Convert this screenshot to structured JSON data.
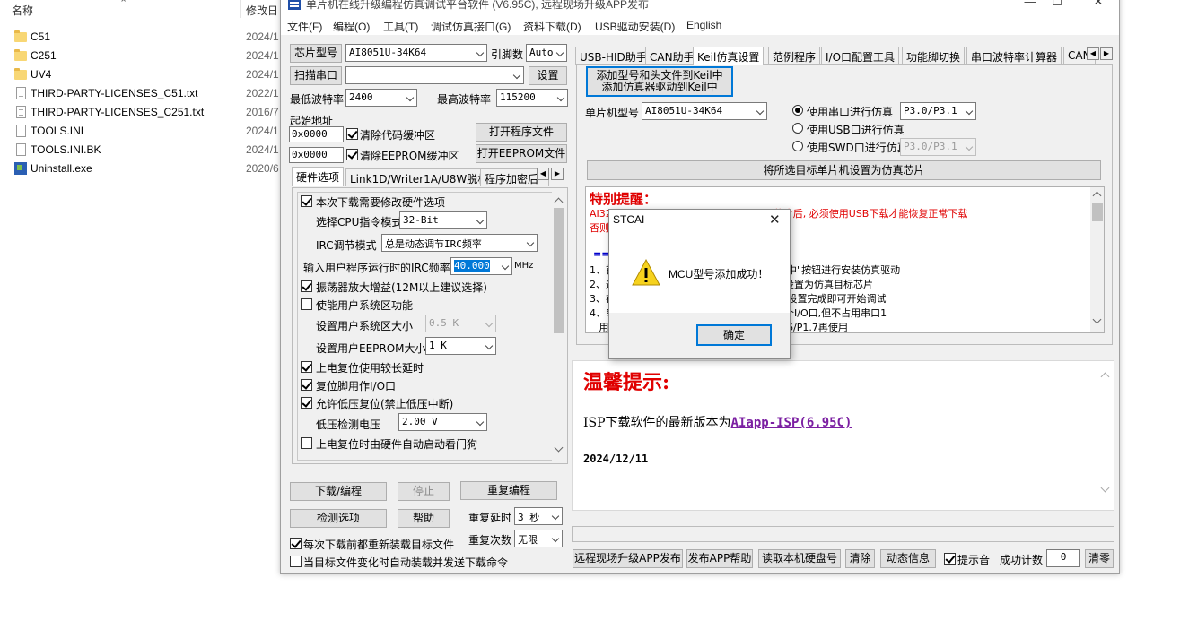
{
  "explorer": {
    "col_name": "名称",
    "col_date": "修改日",
    "files": [
      {
        "name": "C51",
        "date": "2024/1",
        "icon": "folder-icon"
      },
      {
        "name": "C251",
        "date": "2024/1",
        "icon": "folder-icon"
      },
      {
        "name": "UV4",
        "date": "2024/1",
        "icon": "folder-icon"
      },
      {
        "name": "THIRD-PARTY-LICENSES_C51.txt",
        "date": "2022/1",
        "icon": "text-file-icon"
      },
      {
        "name": "THIRD-PARTY-LICENSES_C251.txt",
        "date": "2016/7",
        "icon": "text-file-icon"
      },
      {
        "name": "TOOLS.INI",
        "date": "2024/1",
        "icon": "ini-file-icon"
      },
      {
        "name": "TOOLS.INI.BK",
        "date": "2024/1",
        "icon": "file-icon"
      },
      {
        "name": "Uninstall.exe",
        "date": "2020/6",
        "icon": "exe-icon"
      }
    ]
  },
  "window": {
    "title": "单片机在线升级编程仿真调试平台软件 (V6.95C), 远程现场升级APP发布",
    "menu": [
      "文件(F)",
      "编程(O)",
      "工具(T)",
      "调试仿真接口(G)",
      "资料下载(D)",
      "USB驱动安装(D)",
      "English"
    ]
  },
  "left": {
    "chip_label": "芯片型号",
    "chip_value": "AI8051U-34K64",
    "pin_label": "引脚数",
    "pin_value": "Auto",
    "scan_label": "扫描串口",
    "port_value": "",
    "settings_label": "设置",
    "min_baud_label": "最低波特率",
    "min_baud_value": "2400",
    "max_baud_label": "最高波特率",
    "max_baud_value": "115200",
    "start_addr_label": "起始地址",
    "code_addr": "0x0000",
    "clear_code_label": "清除代码缓冲区",
    "open_prog_label": "打开程序文件",
    "eeprom_addr": "0x0000",
    "clear_eeprom_label": "清除EEPROM缓冲区",
    "open_eeprom_label": "打开EEPROM文件",
    "tabs": [
      "硬件选项",
      "Link1D/Writer1A/U8W脱机",
      "程序加密后"
    ],
    "hw": {
      "modify_hw": "本次下载需要修改硬件选项",
      "cpu_mode_label": "选择CPU指令模式",
      "cpu_mode_value": "32-Bit",
      "irc_label": "IRC调节模式",
      "irc_value": "总是动态调节IRC频率",
      "freq_label": "输入用户程序运行时的IRC频率",
      "freq_value": "40.000",
      "freq_unit": "MHz",
      "osc_gain": "振荡器放大增益(12M以上建议选择)",
      "sys_area": "使能用户系统区功能",
      "sys_size_label": "设置用户系统区大小",
      "sys_size_value": "0.5 K",
      "eeprom_size_label": "设置用户EEPROM大小",
      "eeprom_size_value": "1   K",
      "long_delay": "上电复位使用较长延时",
      "reset_io": "复位脚用作I/O口",
      "low_volt_reset": "允许低压复位(禁止低压中断)",
      "low_volt_label": "低压检测电压",
      "low_volt_value": "2.00 V",
      "watchdog": "上电复位时由硬件自动启动看门狗"
    },
    "download_btn": "下载/编程",
    "stop_btn": "停止",
    "reprog_btn": "重复编程",
    "detect_btn": "检测选项",
    "help_btn": "帮助",
    "repeat_delay_label": "重复延时",
    "repeat_delay_value": "3 秒",
    "repeat_count_label": "重复次数",
    "repeat_count_value": "无限",
    "reload_label": "每次下载前都重新装载目标文件",
    "auto_load_label": "当目标文件变化时自动装载并发送下载命令"
  },
  "right": {
    "tabs": [
      "USB-HID助手",
      "CAN助手",
      "Keil仿真设置",
      "范例程序",
      "I/O口配置工具",
      "功能脚切换",
      "串口波特率计算器",
      "CAN"
    ],
    "add_keil_line1": "添加型号和头文件到Keil中",
    "add_keil_line2": "添加仿真器驱动到Keil中",
    "mcu_label": "单片机型号",
    "mcu_value": "AI8051U-34K64",
    "uart_sim_label": "使用串口进行仿真",
    "uart_sim_value": "P3.0/P3.1",
    "usb_sim_label": "使用USB口进行仿真",
    "swd_sim_label": "使用SWD口进行仿真",
    "swd_sim_value": "P3.0/P3.1",
    "set_chip_btn": "将所选目标单片机设置为仿真芯片",
    "notice_title": "特别提醒：",
    "notice_red1_a": "AI32",
    "notice_red1_b": "芯片后, 必须使用USB下载才能恢复正常下载",
    "notice_red2": "否则",
    "notice_arrow": "==>",
    "notice_lines": [
      {
        "a": "1、首",
        "b": "l中\"按钮进行安装仿真驱动"
      },
      {
        "a": "2、选",
        "b": "设置为仿真目标芯片"
      },
      {
        "a": "3、在",
        "b": ",设置完成即可开始调试"
      },
      {
        "a": "4、串",
        "b": "个I/O口,但不占用串口1"
      },
      {
        "a": "   用",
        "b": "1.6/P1.7再使用"
      }
    ],
    "tip_title": "温馨提示:",
    "tip_text": "ISP下载软件的最新版本为",
    "tip_link": "AIapp-ISP(6.95C)",
    "tip_date": "2024/12/11",
    "remote_btn": "远程现场升级APP发布",
    "publish_help_btn": "发布APP帮助",
    "read_disk_btn": "读取本机硬盘号",
    "clear_btn": "清除",
    "dynamic_btn": "动态信息",
    "beep_label": "提示音",
    "success_label": "成功计数",
    "success_value": "0",
    "reset_count_btn": "清零"
  },
  "dialog": {
    "title": "STCAI",
    "message": "MCU型号添加成功！",
    "ok": "确定"
  }
}
